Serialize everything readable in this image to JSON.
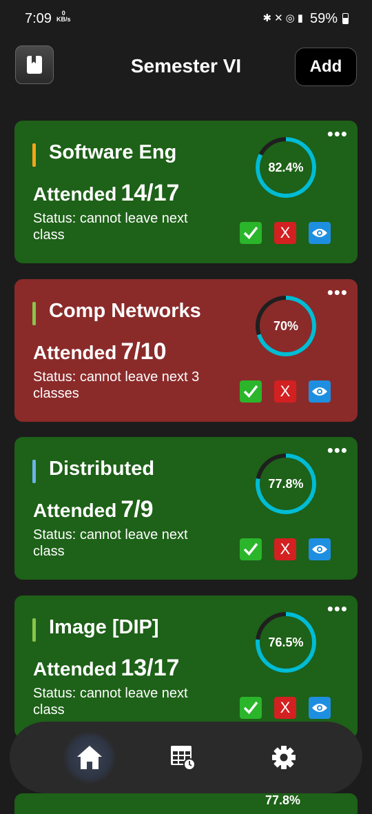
{
  "status_bar": {
    "time": "7:09",
    "net_speed_value": "0",
    "net_speed_unit": "KB/s",
    "battery": "59%",
    "icons": [
      "bluetooth-icon",
      "mute-icon",
      "hotspot-icon",
      "volte-icon",
      "5g-icon",
      "signal-icon",
      "battery-icon"
    ]
  },
  "header": {
    "title": "Semester VI",
    "add_label": "Add",
    "left_icon": "book-icon"
  },
  "cards": [
    {
      "subject": "Software Eng",
      "attended_label": "Attended",
      "attended": "14/17",
      "percent_text": "82.4%",
      "percent": 82.4,
      "status": "Status: cannot leave next class",
      "theme": "green",
      "bar_color": "#f4a61d"
    },
    {
      "subject": "Comp Networks",
      "attended_label": "Attended",
      "attended": "7/10",
      "percent_text": "70%",
      "percent": 70,
      "status": "Status: cannot leave next 3 classes",
      "theme": "red",
      "bar_color": "#8bc34a"
    },
    {
      "subject": "Distributed",
      "attended_label": "Attended",
      "attended": "7/9",
      "percent_text": "77.8%",
      "percent": 77.8,
      "status": "Status: cannot leave next class",
      "theme": "green",
      "bar_color": "#6ab4e8"
    },
    {
      "subject": "Image [DIP]",
      "attended_label": "Attended",
      "attended": "13/17",
      "percent_text": "76.5%",
      "percent": 76.5,
      "status": "Status: cannot leave next class",
      "theme": "green",
      "bar_color": "#8bc34a"
    }
  ],
  "peek_card": {
    "percent_text": "77.8%"
  },
  "actions": {
    "more": "•••",
    "present": "✓",
    "absent": "X"
  },
  "bottom_nav": {
    "items": [
      "home-icon",
      "schedule-icon",
      "settings-icon"
    ],
    "active": "home-icon"
  },
  "colors": {
    "ring": "#00bcd4",
    "ring_track": "#1f1f1f",
    "green_card": "#1e6118",
    "red_card": "#8a2b2a"
  }
}
